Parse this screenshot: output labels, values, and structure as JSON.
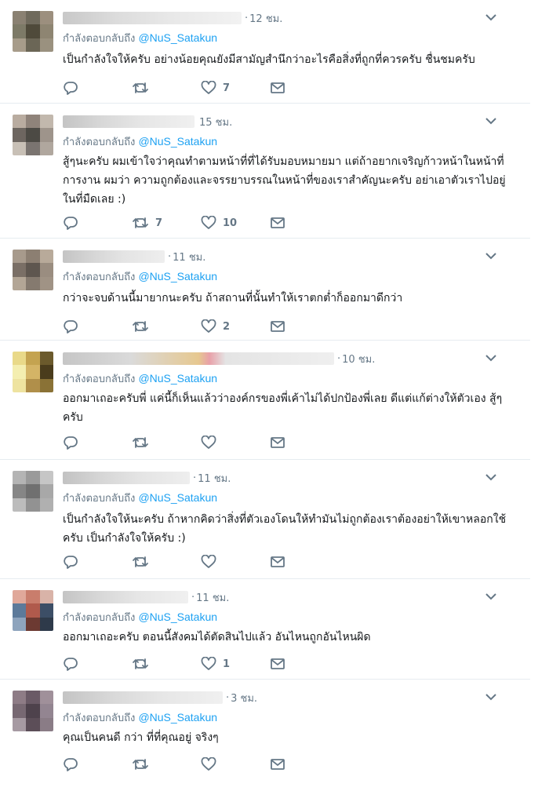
{
  "reply_prefix": "กำลังตอบกลับถึง",
  "reply_handle": "@NuS_Satakun",
  "tweets": [
    {
      "time": "12 ชม.",
      "text": "เป็นกำลังใจให้ครับ อย่างน้อยคุณยังมีสามัญสำนึกว่าอะไรคือสิ่งที่ถูกที่ควรครับ ชื่นชมครับ",
      "replies": "",
      "retweets": "",
      "likes": "7",
      "avatar": [
        "#8a8172",
        "#6f6a5c",
        "#9c8f7e",
        "#7d7a67",
        "#4f4a3a",
        "#8e8572",
        "#a79c8a",
        "#6b6656",
        "#9a917f"
      ]
    },
    {
      "time": "15 ชม.",
      "text": "สู้ๆนะครับ ผมเข้าใจว่าคุณทำตามหน้าที่ที่ได้รับมอบหมายมา แต่ถ้าอยากเจริญก้าวหน้าในหน้าที่การงาน ผมว่า ความถูกต้องและจรรยาบรรณในหน้าที่ของเราสำคัญนะครับ อย่าเอาตัวเราไปอยู่ในที่มืดเลย :)",
      "replies": "",
      "retweets": "7",
      "likes": "10",
      "avatar": [
        "#b9aca0",
        "#8f837a",
        "#c2b8ad",
        "#6d6660",
        "#4c4a44",
        "#9e948b",
        "#c8c0b6",
        "#7a7470",
        "#b0a79e"
      ]
    },
    {
      "time": "11 ชม.",
      "text": "กว่าจะจบด้านนี้มายากนะครับ ถ้าสถานที่นั้นทำให้เราตกต่ำก็ออกมาดีกว่า",
      "replies": "",
      "retweets": "",
      "likes": "2",
      "avatar": [
        "#a79a8c",
        "#8c7f72",
        "#b8aa9a",
        "#7a6f66",
        "#5e564f",
        "#9a8d80",
        "#b3a696",
        "#857a6f",
        "#a09385"
      ]
    },
    {
      "time": "10 ชม.",
      "text": "ออกมาเถอะครับพี่ แค่นี้ก็เห็นแล้วว่าองค์กรของพี่เค้าไม่ได้ปกป้องพี่เลย ดีแต่แก้ต่างให้ตัวเอง สู้ๆ ครับ",
      "replies": "",
      "retweets": "",
      "likes": "",
      "avatar": [
        "#e9d989",
        "#c4a350",
        "#6b5a2c",
        "#f4eeb0",
        "#d4b466",
        "#4a3c1c",
        "#eee3a0",
        "#b08f4a",
        "#8a7236"
      ]
    },
    {
      "time": "11 ชม.",
      "text": "เป็นกำลังใจให้นะครับ ถ้าหากคิดว่าสิ่งที่ตัวเองโดนให้ทำมันไม่ถูกต้องเราต้องอย่าให้เขาหลอกใช้ครับ เป็นกำลังใจให้ครับ :)",
      "replies": "",
      "retweets": "",
      "likes": "",
      "avatar": [
        "#b4b4b4",
        "#9a9a9a",
        "#c6c6c6",
        "#868686",
        "#707070",
        "#a8a8a8",
        "#bcbcbc",
        "#929292",
        "#b0b0b0"
      ]
    },
    {
      "time": "11 ชม.",
      "text": "ออกมาเถอะครับ ตอนนี้สังคมได้ตัดสินไปแล้ว อันไหนถูกอันไหนผิด",
      "replies": "",
      "retweets": "",
      "likes": "1",
      "avatar": [
        "#e0a89a",
        "#c97d6c",
        "#d9b3a8",
        "#5d7a9a",
        "#b05a4c",
        "#3c4e66",
        "#8ea4bd",
        "#6c3a32",
        "#2e3a4a"
      ]
    },
    {
      "time": "3 ชม.",
      "text": "คุณเป็นคนดี กว่า ที่ที่คุณอยู่ จริงๆ",
      "replies": "",
      "retweets": "",
      "likes": "",
      "avatar": [
        "#8e7c86",
        "#6a5a66",
        "#a0909a",
        "#776872",
        "#4e424c",
        "#938591",
        "#a69aa2",
        "#5c4e58",
        "#8a7c86"
      ]
    }
  ]
}
